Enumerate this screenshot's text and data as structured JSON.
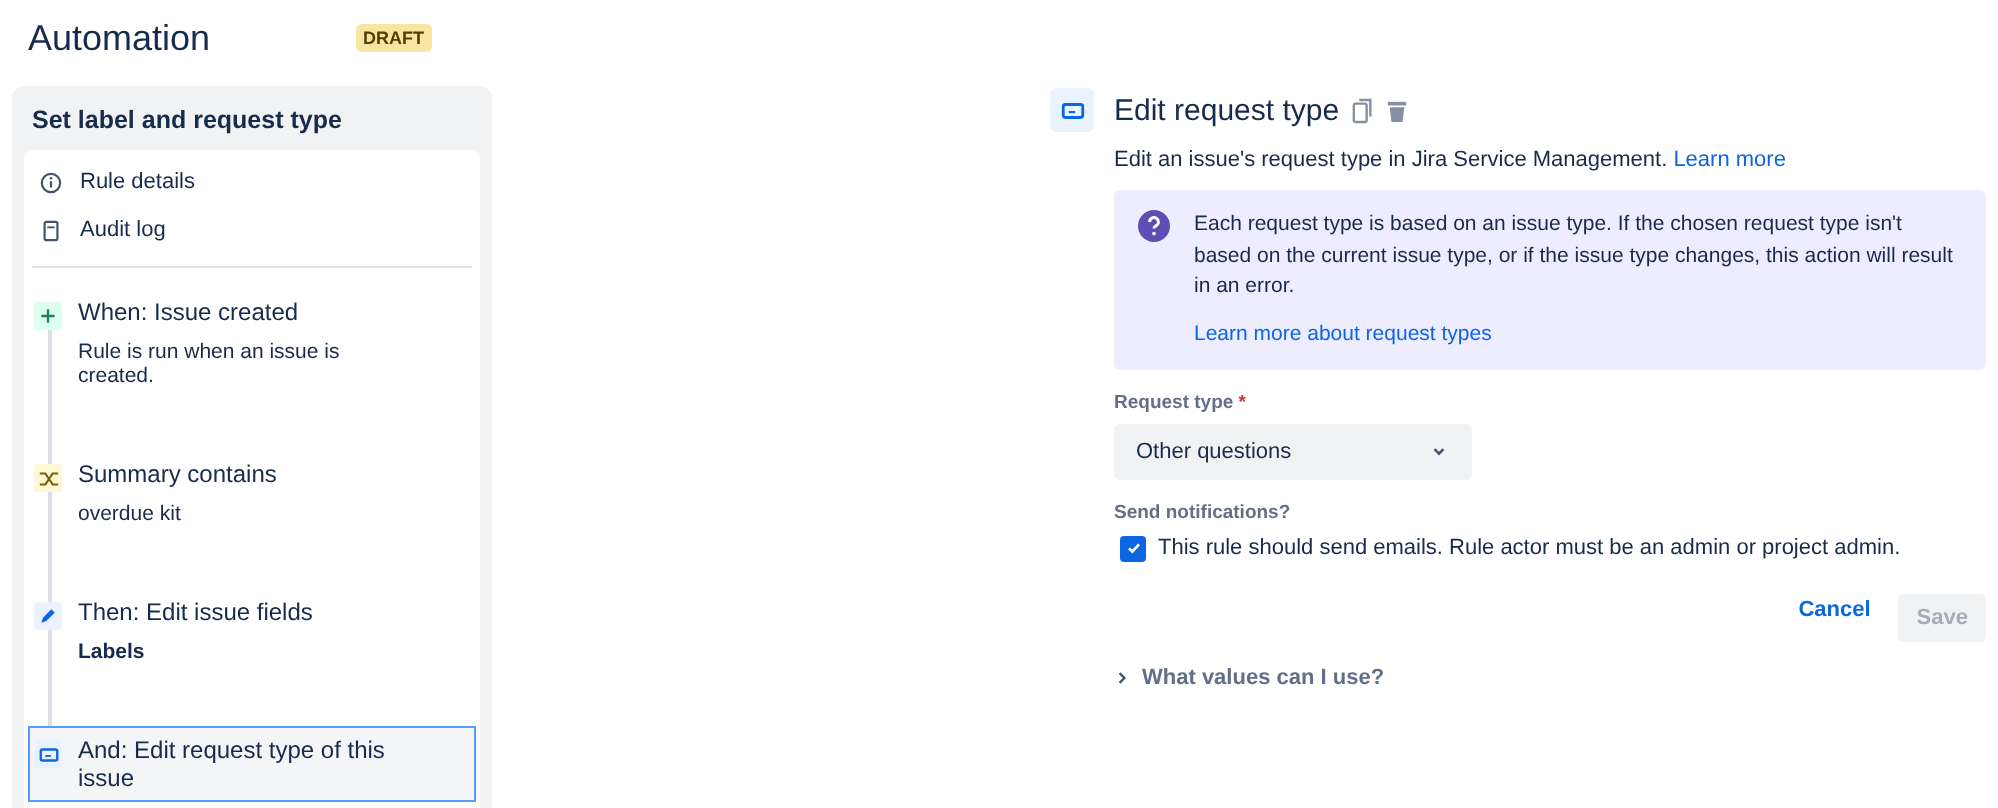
{
  "header": {
    "title": "Automation",
    "badge": "DRAFT"
  },
  "sidebar": {
    "title": "Set label and request type",
    "links": [
      {
        "kind": "info",
        "label": "Rule details"
      },
      {
        "kind": "log",
        "label": "Audit log"
      }
    ],
    "steps": [
      {
        "kind": "trigger",
        "title": "When: Issue created",
        "detail": "Rule is run when an issue is created.",
        "detail_bold": false,
        "selected": false
      },
      {
        "kind": "condition",
        "title": "Summary contains",
        "detail": "overdue kit",
        "detail_bold": false,
        "selected": false
      },
      {
        "kind": "edit",
        "title": "Then: Edit issue fields",
        "detail": "Labels",
        "detail_bold": true,
        "selected": false
      },
      {
        "kind": "request",
        "title": "And: Edit request type of this issue",
        "selected": true
      }
    ]
  },
  "panel": {
    "title": "Edit request type",
    "description": "Edit an issue's request type in Jira Service Management.",
    "description_link": "Learn more",
    "notice": {
      "text": "Each request type is based on an issue type. If the chosen request type isn't based on the current issue type, or if the issue type changes, this action will result in an error.",
      "link": "Learn more about request types"
    },
    "request_type": {
      "label": "Request type",
      "required_mark": "*",
      "value": "Other questions"
    },
    "notifications": {
      "label": "Send notifications?",
      "checkbox_label": "This rule should send emails. Rule actor must be an admin or project admin.",
      "checked": true
    },
    "buttons": [
      {
        "kind": "link",
        "label": "Cancel",
        "disabled": false
      },
      {
        "kind": "primary",
        "label": "Save",
        "disabled": true
      }
    ],
    "help": {
      "label": "What values can I use?",
      "expanded": false
    }
  }
}
